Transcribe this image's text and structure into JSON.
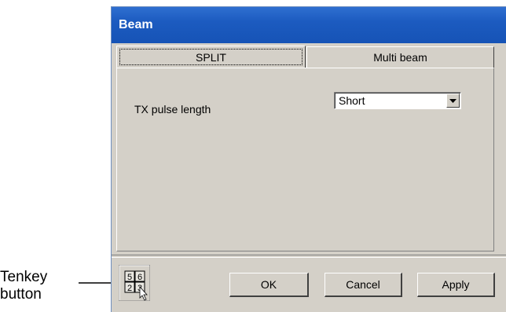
{
  "annotation": {
    "line1": "Tenkey",
    "line2": "button"
  },
  "window": {
    "title": "Beam"
  },
  "tabs": [
    {
      "label": "SPLIT",
      "active": true
    },
    {
      "label": "Multi beam",
      "active": false
    }
  ],
  "settings": {
    "tx_pulse_label": "TX pulse length",
    "tx_pulse_value": "Short"
  },
  "tenkey": {
    "keys": [
      "5",
      "6",
      "2",
      "3"
    ]
  },
  "buttons": {
    "ok": "OK",
    "cancel": "Cancel",
    "apply": "Apply"
  },
  "colors": {
    "titlebar": "#1c5bc0",
    "face": "#d4d0c8"
  }
}
